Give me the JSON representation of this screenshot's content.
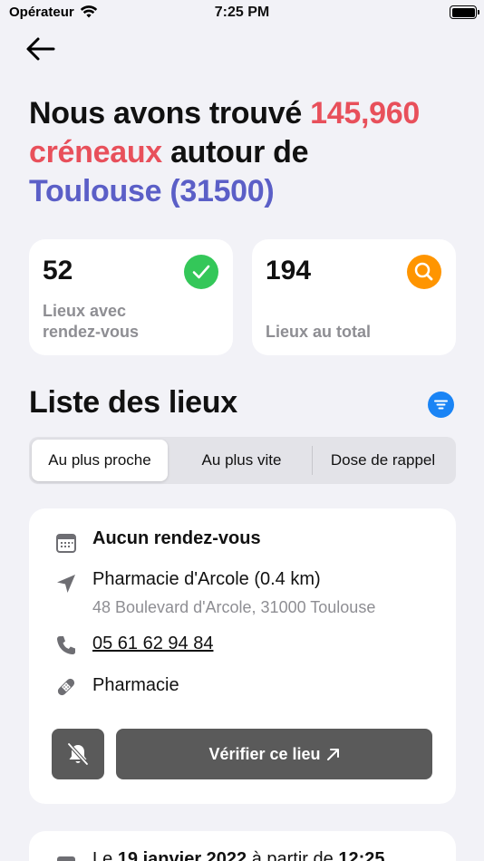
{
  "status_bar": {
    "carrier": "Opérateur",
    "time": "7:25 PM"
  },
  "header": {
    "back_icon": "arrow-left-icon",
    "headline": {
      "part1": "Nous avons trouvé ",
      "count": "145,960",
      "line2_red": "créneaux",
      "line2_rest": " autour de",
      "location": "Toulouse (31500)"
    }
  },
  "stats": [
    {
      "value": "52",
      "label": "Lieux avec rendez-vous",
      "icon": "checkmark-icon",
      "color": "#34c759"
    },
    {
      "value": "194",
      "label": "Lieux au total",
      "icon": "search-icon",
      "color": "#ff9500"
    }
  ],
  "list": {
    "title": "Liste des lieux",
    "filter_icon": "filter-icon",
    "tabs": [
      {
        "label": "Au plus proche",
        "selected": true
      },
      {
        "label": "Au plus vite",
        "selected": false
      },
      {
        "label": "Dose de rappel",
        "selected": false
      }
    ]
  },
  "place": {
    "availability": "Aucun rendez-vous",
    "name": "Pharmacie d'Arcole (0.4 km)",
    "address": "48 Boulevard d'Arcole, 31000 Toulouse",
    "phone": "05 61 62 94 84",
    "type": "Pharmacie",
    "verify_label": "Vérifier ce lieu",
    "bell_icon": "bell-slash-icon"
  },
  "next_place": {
    "prefix": "Le ",
    "date": "19 janvier 2022",
    "middle": " à partir de ",
    "time": "12:25"
  }
}
